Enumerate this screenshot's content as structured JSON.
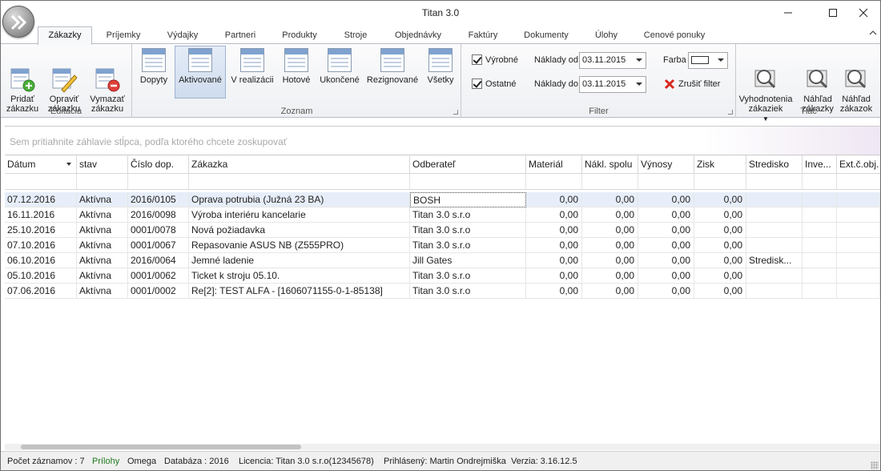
{
  "window": {
    "title": "Titan 3.0"
  },
  "tabs": [
    {
      "label": "Zákazky",
      "active": true
    },
    {
      "label": "Príjemky"
    },
    {
      "label": "Výdajky"
    },
    {
      "label": "Partneri"
    },
    {
      "label": "Produkty"
    },
    {
      "label": "Stroje"
    },
    {
      "label": "Objednávky"
    },
    {
      "label": "Faktúry"
    },
    {
      "label": "Dokumenty"
    },
    {
      "label": "Úlohy"
    },
    {
      "label": "Cenové ponuky"
    }
  ],
  "ribbon": {
    "editacia": {
      "label": "Editácia",
      "add": "Pridať\nzákazku",
      "edit": "Opraviť\nzákazku",
      "delete": "Vymazať\nzákazku"
    },
    "zoznam": {
      "label": "Zoznam",
      "items": [
        "Dopyty",
        "Aktivované",
        "V realizácii",
        "Hotové",
        "Ukončené",
        "Rezignované",
        "Všetky"
      ],
      "selected": "Aktivované"
    },
    "filter": {
      "label": "Filter",
      "vyrobne": "Výrobné",
      "ostatne": "Ostatné",
      "naklady_od_label": "Náklady od",
      "naklady_od": "03.11.2015",
      "naklady_do_label": "Náklady do",
      "naklady_do": "03.11.2015",
      "farba_label": "Farba",
      "cancel": "Zrušiť filter"
    },
    "tlac": {
      "label": "Tlač",
      "eval": "Vyhodnotenia\nzákaziek",
      "preview_order": "Náhľad\nzákazky",
      "preview_orders": "Náhľad\nzákazok"
    }
  },
  "grid": {
    "group_hint": "Sem pritiahnite záhlavie stĺpca, podľa ktorého chcete zoskupovať",
    "columns": [
      "Dátum",
      "stav",
      "Číslo dop.",
      "Zákazka",
      "Odberateľ",
      "Materiál",
      "Nákl. spolu",
      "Výnosy",
      "Zisk",
      "Stredisko",
      "Inve...",
      "Ext.č.obj."
    ],
    "rows": [
      [
        "07.12.2016",
        "Aktívna",
        "2016/0105",
        "Oprava potrubia (Južná 23 BA)",
        "BOSH",
        "0,00",
        "0,00",
        "0,00",
        "0,00",
        "",
        "",
        ""
      ],
      [
        "16.11.2016",
        "Aktívna",
        "2016/0098",
        "Výroba interiéru kancelarie",
        "Titan 3.0 s.r.o",
        "0,00",
        "0,00",
        "0,00",
        "0,00",
        "",
        "",
        ""
      ],
      [
        "25.10.2016",
        "Aktívna",
        "0001/0078",
        "Nová požiadavka",
        "Titan 3.0 s.r.o",
        "0,00",
        "0,00",
        "0,00",
        "0,00",
        "",
        "",
        ""
      ],
      [
        "07.10.2016",
        "Aktívna",
        "0001/0067",
        "Repasovanie ASUS NB (Z555PRO)",
        "Titan 3.0 s.r.o",
        "0,00",
        "0,00",
        "0,00",
        "0,00",
        "",
        "",
        ""
      ],
      [
        "06.10.2016",
        "Aktívna",
        "2016/0064",
        "Jemné ladenie",
        "Jill Gates",
        "0,00",
        "0,00",
        "0,00",
        "0,00",
        "Stredisk...",
        "",
        ""
      ],
      [
        "05.10.2016",
        "Aktívna",
        "0001/0062",
        "Ticket k stroju 05.10.",
        "Titan 3.0 s.r.o",
        "0,00",
        "0,00",
        "0,00",
        "0,00",
        "",
        "",
        ""
      ],
      [
        "07.06.2016",
        "Aktívna",
        "0001/0002",
        "Re[2]: TEST ALFA - [1606071155-0-1-85138]",
        "Titan 3.0 s.r.o",
        "0,00",
        "0,00",
        "0,00",
        "0,00",
        "",
        "",
        ""
      ]
    ]
  },
  "status": {
    "count": "Počet záznamov : 7",
    "attachments": "Prílohy",
    "omega": "Omega",
    "database": "Databáza : 2016",
    "license": "Licencia: Titan 3.0 s.r.o(12345678)",
    "user": "Prihlásený: Martin Ondrejmiška",
    "version": "Verzia: 3.16.12.5"
  },
  "colors": {
    "selected_row": "#e7eef9",
    "accent": "#7fa2cf",
    "green_status": "#1e7a1e"
  }
}
